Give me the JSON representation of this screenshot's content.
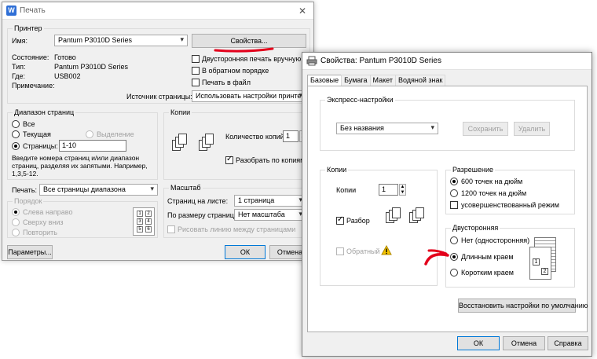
{
  "print_dialog": {
    "title": "Печать",
    "printer_group": "Принтер",
    "name_label": "Имя:",
    "printer_name": "Pantum P3010D Series",
    "properties_button": "Свойства...",
    "status_label": "Состояние:",
    "status_value": "Готово",
    "type_label": "Тип:",
    "type_value": "Pantum P3010D Series",
    "where_label": "Где:",
    "where_value": "USB002",
    "comment_label": "Примечание:",
    "duplex_manual": "Двусторонняя печать вручную",
    "reverse_order": "В обратном порядке",
    "print_to_file": "Печать в файл",
    "paper_source_label": "Источник страницы:",
    "paper_source_value": "Использовать настройки принтера",
    "range_group": "Диапазон страниц",
    "range_all": "Все",
    "range_current": "Текущая",
    "range_selection": "Выделение",
    "range_pages": "Страницы:",
    "range_pages_value": "1-10",
    "range_hint": "Введите номера страниц и/или диапазон страниц, разделяя их запятыми. Например, 1,3,5-12.",
    "copies_group": "Копии",
    "copies_count_label": "Количество копий:",
    "copies_count_value": "1",
    "collate": "Разобрать по копиям",
    "print_label": "Печать:",
    "print_value": "Все страницы диапазона",
    "order_group": "Порядок",
    "order_lr": "Слева направо",
    "order_tb": "Сверху вниз",
    "order_repeat": "Повторить",
    "scale_group": "Масштаб",
    "pages_per_sheet_label": "Страниц на листе:",
    "pages_per_sheet_value": "1 страница",
    "fit_label": "По размеру страницы:",
    "fit_value": "Нет масштаба",
    "draw_borders": "Рисовать линию между страницами",
    "options_button": "Параметры...",
    "ok_button": "ОК",
    "cancel_button": "Отмена",
    "grid_numbers": [
      "1",
      "2",
      "3",
      "4",
      "5",
      "6"
    ]
  },
  "props_dialog": {
    "title": "Свойства: Pantum P3010D Series",
    "tabs": [
      "Базовые",
      "Бумага",
      "Макет",
      "Водяной знак"
    ],
    "express_group": "Экспресс-настройки",
    "express_value": "Без названия",
    "save_button": "Сохранить",
    "delete_button": "Удалить",
    "copies_group": "Копии",
    "copies_label": "Копии",
    "copies_value": "1",
    "collate": "Разбор",
    "reverse": "Обратный",
    "resolution_group": "Разрешение",
    "res_600": "600 точек на дюйм",
    "res_1200": "1200 точек на дюйм",
    "res_enhanced": "усовершенствованный режим",
    "duplex_group": "Двусторонняя",
    "duplex_none": "Нет (односторонняя)",
    "duplex_long": "Длинным краем",
    "duplex_short": "Коротким краем",
    "restore_button": "Восстановить настройки по умолчанию",
    "ok_button": "ОК",
    "cancel_button": "Отмена",
    "help_button": "Справка",
    "stack_numbers": [
      "1",
      "2",
      "3"
    ]
  },
  "colors": {
    "annotation_red": "#e3001b",
    "accent": "#0078d7"
  }
}
